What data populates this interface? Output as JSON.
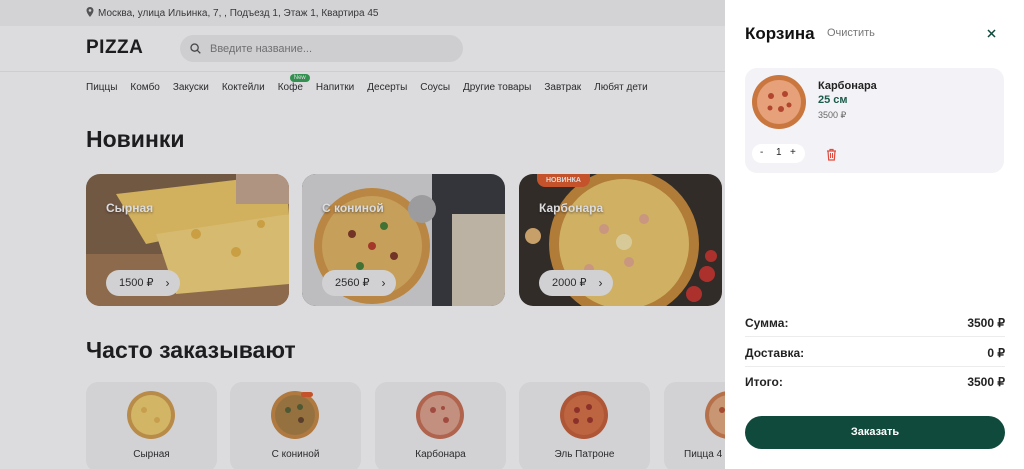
{
  "topbar": {
    "address": "Москва, улица Ильинка, 7, , Подъезд 1, Этаж 1, Квартира 45"
  },
  "header": {
    "logo": "PIZZA",
    "search_placeholder": "Введите название..."
  },
  "nav": {
    "items": [
      "Пиццы",
      "Комбо",
      "Закуски",
      "Коктейли",
      "Кофе",
      "Напитки",
      "Десерты",
      "Соусы",
      "Другие товары",
      "Завтрак",
      "Любят дети"
    ],
    "new_badge": "New"
  },
  "new_section": {
    "title": "Новинки",
    "promos": [
      {
        "name": "Сырная",
        "price": "1500 ₽"
      },
      {
        "name": "С кониной",
        "price": "2560 ₽"
      },
      {
        "name": "Карбонара",
        "price": "2000 ₽",
        "badge": "НОВИНКА"
      }
    ]
  },
  "often_section": {
    "title": "Часто заказывают",
    "items": [
      "Сырная",
      "С кониной",
      "Карбонара",
      "Эль Патроне",
      "Пицца 4"
    ]
  },
  "cart": {
    "title": "Корзина",
    "clear_label": "Очистить",
    "item": {
      "name": "Карбонара",
      "size": "25 см",
      "price": "3500 ₽",
      "qty": "1",
      "minus": "-",
      "plus": "+"
    },
    "summary": [
      {
        "label": "Сумма:",
        "value": "3500 ₽"
      },
      {
        "label": "Доставка:",
        "value": "0 ₽"
      },
      {
        "label": "Итого:",
        "value": "3500 ₽"
      }
    ],
    "order_label": "Заказать"
  },
  "colors": {
    "accent": "#0f4a3d",
    "size_text": "#1c5b4b",
    "badge": "#e1531f",
    "new_badge": "#2ba24c",
    "trash": "#e14a3c"
  },
  "icons": {
    "topbar": "location-pin-icon",
    "search": "search-icon",
    "close": "close-icon",
    "delete": "trash-icon",
    "promo_arrow": "chevron-right-icon"
  }
}
